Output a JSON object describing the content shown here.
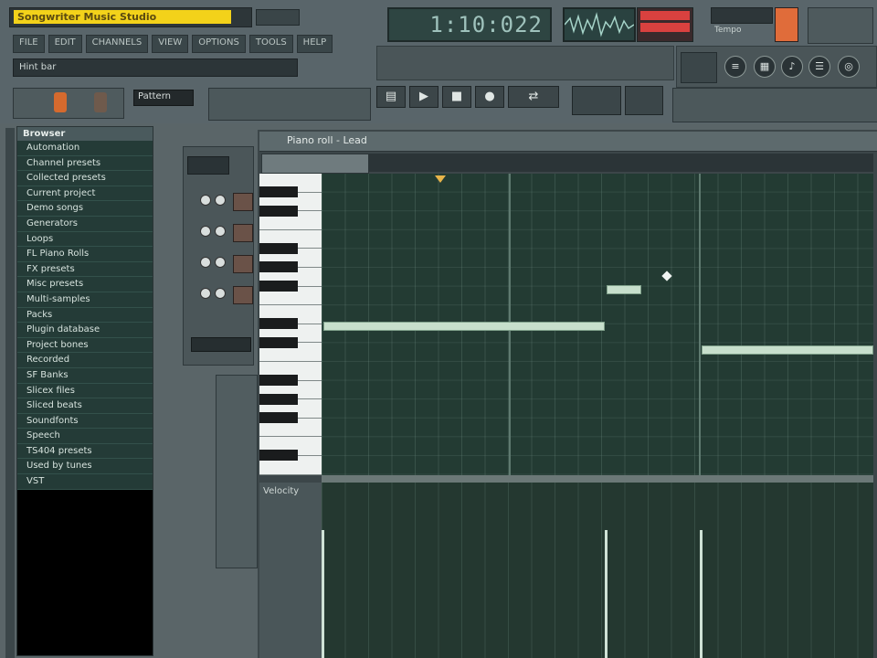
{
  "title": "Songwriter Music Studio",
  "menu": [
    "FILE",
    "EDIT",
    "CHANNELS",
    "VIEW",
    "OPTIONS",
    "TOOLS",
    "HELP"
  ],
  "hint_bar": "Hint bar",
  "time_display": "1:10:022",
  "pattern_selector": "Pattern",
  "tempo_label": "Tempo",
  "browser": {
    "header": "Browser",
    "items": [
      "Automation",
      "Channel presets",
      "Collected presets",
      "Current project",
      "Demo songs",
      "Generators",
      "Loops",
      "FL Piano Rolls",
      "FX presets",
      "Misc presets",
      "Multi-samples",
      "Packs",
      "Plugin database",
      "Project bones",
      "Recorded",
      "SF Banks",
      "Slicex files",
      "Sliced beats",
      "Soundfonts",
      "Speech",
      "TS404 presets",
      "Used by tunes",
      "VST"
    ]
  },
  "piano_roll": {
    "title": "Piano roll - Lead"
  },
  "event_editor": {
    "label": "Velocity"
  },
  "colors": {
    "title_highlight": "#f3d21a",
    "grid_bg": "#233b33",
    "note_fill": "#c7dfcc",
    "browser_bg": "#243b37"
  },
  "icons": [
    "play-icon",
    "stop-icon",
    "record-icon",
    "pattern-mode-icon",
    "song-mode-icon",
    "snap-icon",
    "metronome-icon"
  ]
}
